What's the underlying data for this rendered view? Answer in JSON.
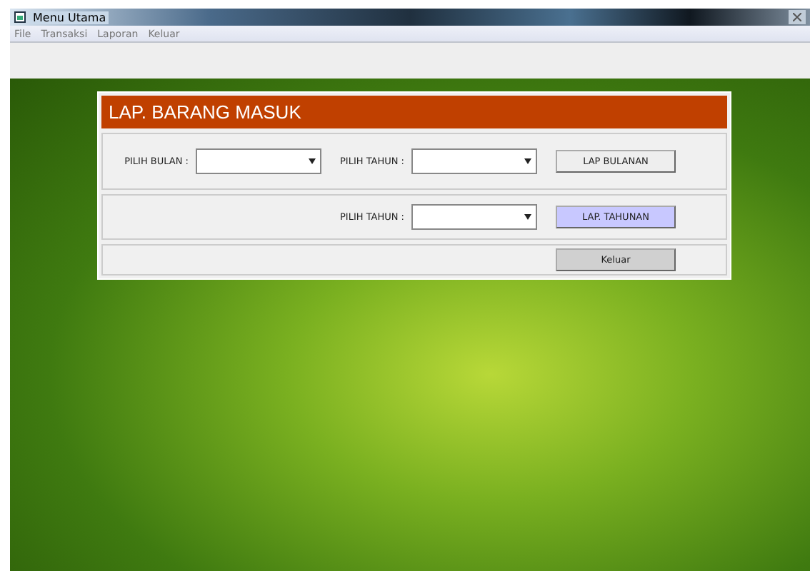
{
  "window": {
    "title": "Menu Utama"
  },
  "menu": [
    "File",
    "Transaksi",
    "Laporan",
    "Keluar"
  ],
  "dialog": {
    "title": "LAP. BARANG MASUK",
    "monthly": {
      "month_label": "PILIH BULAN :",
      "year_label": "PILIH TAHUN :",
      "button": {
        "label": "LAP BULANAN",
        "focused": false
      }
    },
    "yearly": {
      "year_label": "PILIH TAHUN :",
      "button": {
        "label": "LAP. TAHUNAN",
        "focused": true
      }
    },
    "exit_button": {
      "label": "Keluar",
      "focused": false
    }
  }
}
